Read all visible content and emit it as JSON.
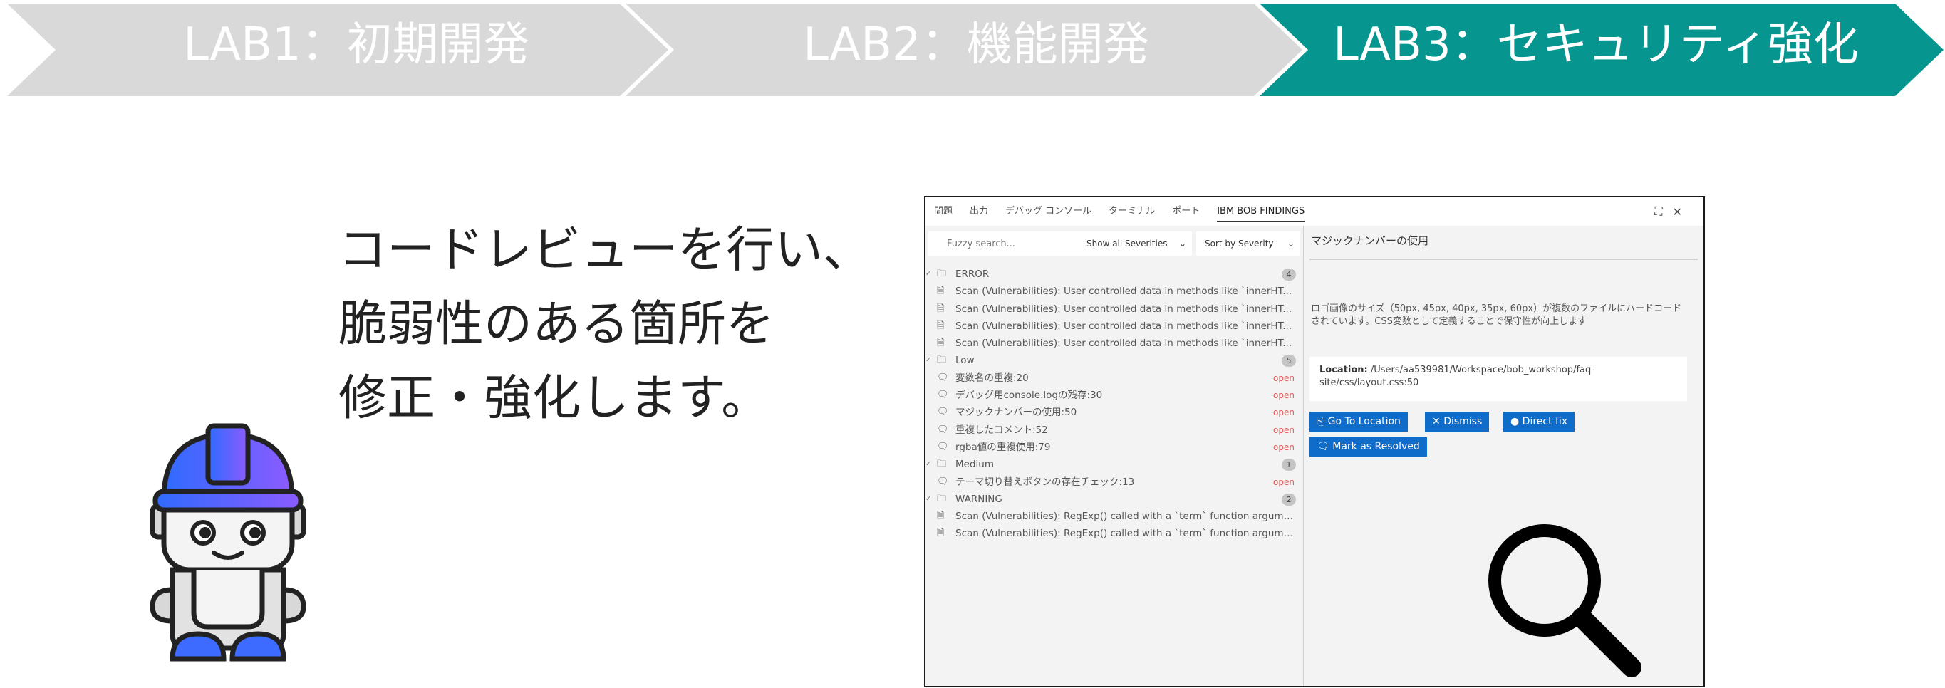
{
  "steps": [
    {
      "label": "LAB1：初期開発",
      "state": "inactive"
    },
    {
      "label": "LAB2：機能開発",
      "state": "inactive"
    },
    {
      "label": "LAB3：セキュリティ強化",
      "state": "active"
    }
  ],
  "colors": {
    "step_inactive": "#d9d9d9",
    "step_active": "#06958f",
    "button": "#0f6cc9",
    "open_status": "#e05a5a",
    "robot_helmet": "#3d6bff"
  },
  "intro": {
    "line1": "コードレビューを行い、",
    "line2": "脆弱性のある箇所を",
    "line3": "修正・強化します。"
  },
  "panel": {
    "tabs": [
      "問題",
      "出力",
      "デバッグ コンソール",
      "ターミナル",
      "ポート",
      "IBM BOB FINDINGS"
    ],
    "active_tab": "IBM BOB FINDINGS",
    "search_placeholder": "Fuzzy search...",
    "severity_filter": "Show all Severities",
    "sort_filter": "Sort by Severity",
    "groups": [
      {
        "name": "ERROR",
        "count": "4",
        "items": [
          {
            "text": "Scan (Vulnerabilities): User controlled data in methods like `innerHT...",
            "status": ""
          },
          {
            "text": "Scan (Vulnerabilities): User controlled data in methods like `innerHT...",
            "status": ""
          },
          {
            "text": "Scan (Vulnerabilities): User controlled data in methods like `innerHT...",
            "status": ""
          },
          {
            "text": "Scan (Vulnerabilities): User controlled data in methods like `innerHT...",
            "status": ""
          }
        ]
      },
      {
        "name": "Low",
        "count": "5",
        "items": [
          {
            "text": "変数名の重複:20",
            "status": "open"
          },
          {
            "text": "デバッグ用console.logの残存:30",
            "status": "open"
          },
          {
            "text": "マジックナンバーの使用:50",
            "status": "open"
          },
          {
            "text": "重複したコメント:52",
            "status": "open"
          },
          {
            "text": "rgba値の重複使用:79",
            "status": "open"
          }
        ]
      },
      {
        "name": "Medium",
        "count": "1",
        "items": [
          {
            "text": "テーマ切り替えボタンの存在チェック:13",
            "status": "open"
          }
        ]
      },
      {
        "name": "WARNING",
        "count": "2",
        "items": [
          {
            "text": "Scan (Vulnerabilities): RegExp() called with a `term` function argume...",
            "status": ""
          },
          {
            "text": "Scan (Vulnerabilities): RegExp() called with a `term` function argume...",
            "status": ""
          }
        ]
      }
    ],
    "detail": {
      "title": "マジックナンバーの使用",
      "description": "ロゴ画像のサイズ（50px, 45px, 40px, 35px, 60px）が複数のファイルにハードコードされています。CSS変数として定義することで保守性が向上します",
      "location_label": "Location:",
      "location_path": "/Users/aa539981/Workspace/bob_workshop/faq-site/css/layout.css:50",
      "buttons": {
        "go_to_location": "Go To Location",
        "dismiss": "Dismiss",
        "direct_fix": "Direct fix",
        "mark_resolved": "Mark as Resolved"
      }
    }
  }
}
